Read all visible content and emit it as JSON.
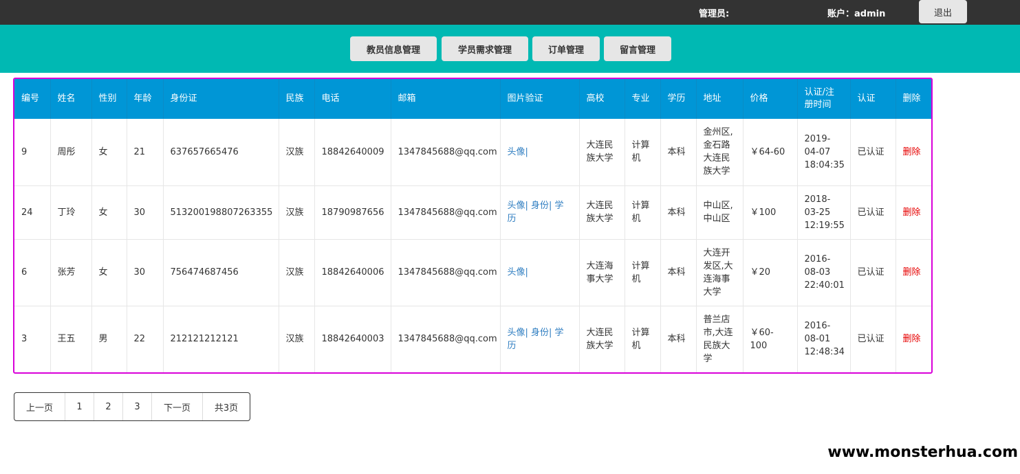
{
  "topbar": {
    "admin_label": "管理员:",
    "account_label": "账户：admin",
    "logout_label": "退出"
  },
  "nav": {
    "items": [
      "教员信息管理",
      "学员需求管理",
      "订单管理",
      "留言管理"
    ]
  },
  "table": {
    "headers": [
      "编号",
      "姓名",
      "性别",
      "年龄",
      "身份证",
      "民族",
      "电话",
      "邮箱",
      "图片验证",
      "高校",
      "专业",
      "学历",
      "地址",
      "价格",
      "认证/注册时间",
      "认证",
      "删除"
    ],
    "rows": [
      [
        "9",
        "周彤",
        "女",
        "21",
        "637657665476",
        "汉族",
        "18842640009",
        "1347845688@qq.com",
        "头像|",
        "大连民族大学",
        "计算机",
        "本科",
        "金州区,金石路大连民族大学",
        "￥64-60",
        "2019-04-07 18:04:35",
        "已认证",
        "删除"
      ],
      [
        "24",
        "丁玲",
        "女",
        "30",
        "513200198807263355",
        "汉族",
        "18790987656",
        "1347845688@qq.com",
        "头像| 身份| 学历",
        "大连民族大学",
        "计算机",
        "本科",
        "中山区,中山区",
        "￥100",
        "2018-03-25 12:19:55",
        "已认证",
        "删除"
      ],
      [
        "6",
        "张芳",
        "女",
        "30",
        "756474687456",
        "汉族",
        "18842640006",
        "1347845688@qq.com",
        "头像|",
        "大连海事大学",
        "计算机",
        "本科",
        "大连开发区,大连海事大学",
        "￥20",
        "2016-08-03 22:40:01",
        "已认证",
        "删除"
      ],
      [
        "3",
        "王五",
        "男",
        "22",
        "212121212121",
        "汉族",
        "18842640003",
        "1347845688@qq.com",
        "头像| 身份| 学历",
        "大连民族大学",
        "计算机",
        "本科",
        "普兰店市,大连民族大学",
        "￥60-100",
        "2016-08-01 12:48:34",
        "已认证",
        "删除"
      ]
    ]
  },
  "pager": {
    "items": [
      "上一页",
      "1",
      "2",
      "3",
      "下一页",
      "共3页"
    ]
  },
  "watermark": "www.monsterhua.com",
  "colors": {
    "topbar": "#333333",
    "navbar": "#00b9b3",
    "table_header": "#0096d6",
    "border_highlight": "#d900d9",
    "link": "#2f7ec1",
    "delete": "#e60000"
  }
}
